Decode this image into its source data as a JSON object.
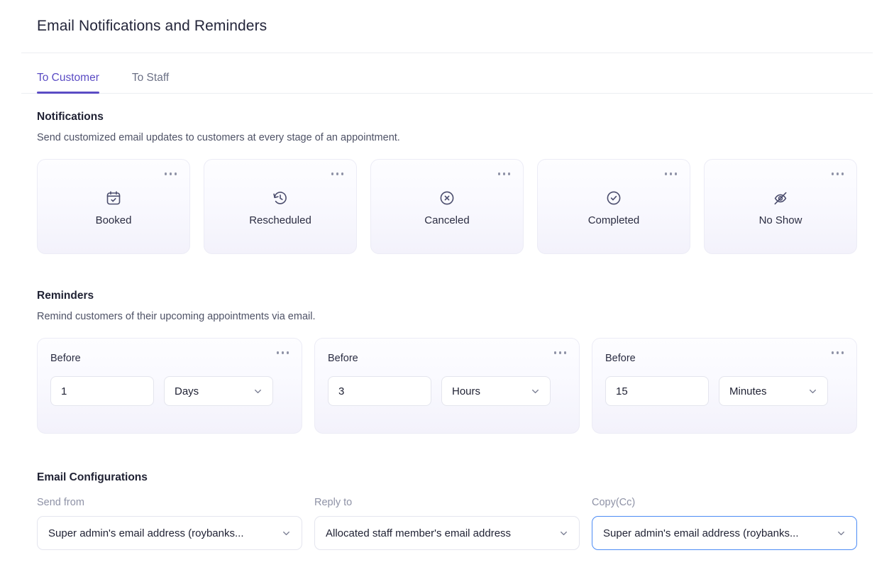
{
  "header": {
    "title": "Email Notifications and Reminders"
  },
  "tabs": [
    {
      "label": "To Customer",
      "active": true
    },
    {
      "label": "To Staff",
      "active": false
    }
  ],
  "notifications": {
    "title": "Notifications",
    "description": "Send customized email updates to customers at every stage of an appointment.",
    "cards": [
      {
        "label": "Booked",
        "icon": "calendar-check-icon"
      },
      {
        "label": "Rescheduled",
        "icon": "clock-history-icon"
      },
      {
        "label": "Canceled",
        "icon": "x-circle-icon"
      },
      {
        "label": "Completed",
        "icon": "check-circle-icon"
      },
      {
        "label": "No Show",
        "icon": "eye-off-icon"
      }
    ],
    "menu_icon": "more-options-icon"
  },
  "reminders": {
    "title": "Reminders",
    "description": "Remind customers of their upcoming appointments via email.",
    "cards": [
      {
        "label": "Before",
        "value": "1",
        "unit": "Days"
      },
      {
        "label": "Before",
        "value": "3",
        "unit": "Hours"
      },
      {
        "label": "Before",
        "value": "15",
        "unit": "Minutes"
      }
    ],
    "unit_options": [
      "Minutes",
      "Hours",
      "Days"
    ]
  },
  "email_configurations": {
    "title": "Email Configurations",
    "fields": [
      {
        "label": "Send from",
        "value": "Super admin's email address (roybanks...",
        "focused": false
      },
      {
        "label": "Reply to",
        "value": "Allocated staff member's email address",
        "focused": false
      },
      {
        "label": "Copy(Cc)",
        "value": "Super admin's email address (roybanks...",
        "focused": true
      }
    ]
  },
  "colors": {
    "accent": "#5b4cc4",
    "focus_border": "#4d8cf5",
    "card_border": "#ececf6",
    "muted_text": "#8e92a6"
  }
}
